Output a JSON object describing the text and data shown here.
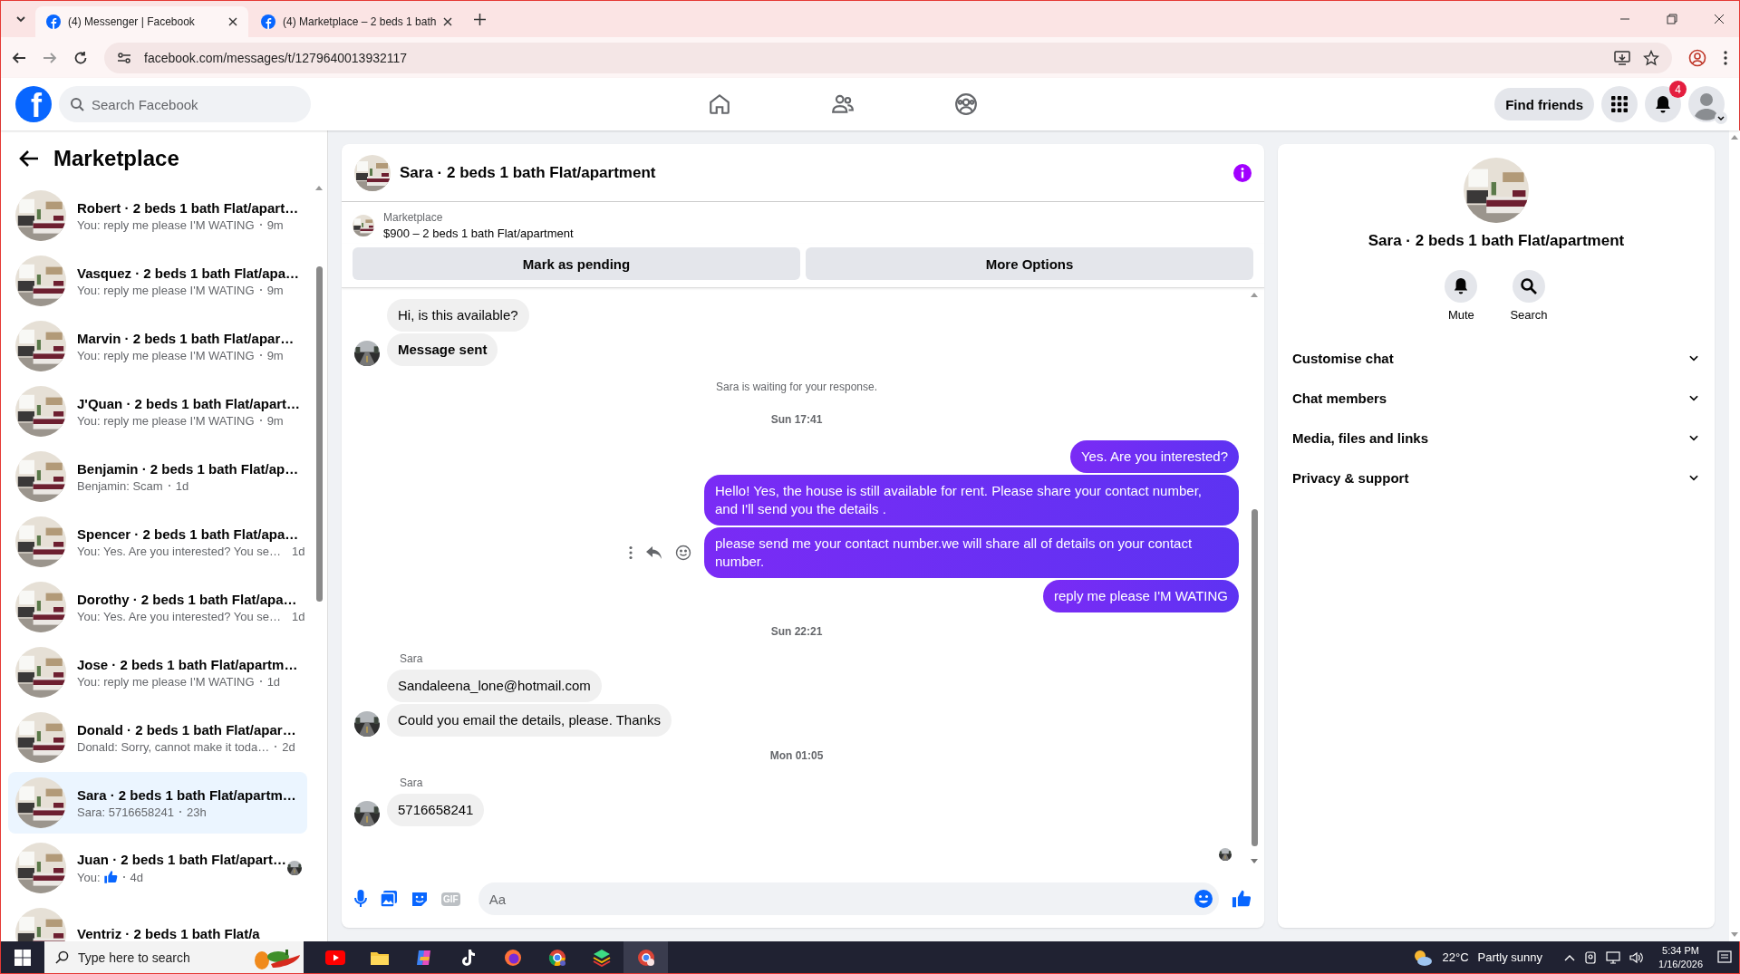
{
  "browser": {
    "tabs": [
      {
        "title": "(4) Messenger | Facebook",
        "selected": true
      },
      {
        "title": "(4) Marketplace – 2 beds 1 bath",
        "selected": false
      }
    ],
    "url": "facebook.com/messages/t/1279640013932117"
  },
  "topnav": {
    "logo": "f",
    "search_placeholder": "Search Facebook",
    "find_friends": "Find friends",
    "notification_count": "4"
  },
  "sidebar": {
    "title": "Marketplace",
    "conversations": [
      {
        "name": "Robert · 2 beds 1 bath Flat/apart…",
        "preview": "You: reply me please I'M WATING",
        "time": "9m",
        "kind": "text",
        "selected": false
      },
      {
        "name": "Vasquez · 2 beds 1 bath Flat/apa…",
        "preview": "You: reply me please I'M WATING",
        "time": "9m",
        "kind": "text",
        "selected": false
      },
      {
        "name": "Marvin · 2 beds 1 bath Flat/apar…",
        "preview": "You: reply me please I'M WATING",
        "time": "9m",
        "kind": "text",
        "selected": false
      },
      {
        "name": "J'Quan · 2 beds 1 bath Flat/apart…",
        "preview": "You: reply me please I'M WATING",
        "time": "9m",
        "kind": "text",
        "selected": false
      },
      {
        "name": "Benjamin · 2 beds 1 bath Flat/ap…",
        "preview": "Benjamin: Scam",
        "time": "1d",
        "kind": "text",
        "selected": false
      },
      {
        "name": "Spencer · 2 beds 1 bath Flat/apa…",
        "preview": "You: Yes. Are you interested? You se…",
        "time": "1d",
        "kind": "text",
        "selected": false
      },
      {
        "name": "Dorothy · 2 beds 1 bath Flat/apa…",
        "preview": "You: Yes. Are you interested? You se…",
        "time": "1d",
        "kind": "text",
        "selected": false
      },
      {
        "name": "Jose · 2 beds 1 bath Flat/apartm…",
        "preview": "You: reply me please I'M WATING",
        "time": "1d",
        "kind": "text",
        "selected": false
      },
      {
        "name": "Donald · 2 beds 1 bath Flat/apar…",
        "preview": "Donald: Sorry, cannot make it toda…",
        "time": "2d",
        "kind": "text",
        "selected": false
      },
      {
        "name": "Sara · 2 beds 1 bath Flat/apartm…",
        "preview": "Sara: 5716658241",
        "time": "23h",
        "kind": "text",
        "selected": true
      },
      {
        "name": "Juan · 2 beds 1 bath Flat/apart…",
        "preview": "You:",
        "time": "4d",
        "kind": "like",
        "selected": false
      },
      {
        "name": "Ventriz · 2 beds 1 bath Flat/a",
        "kind": "cut",
        "selected": false
      }
    ]
  },
  "chat": {
    "title": "Sara · 2 beds 1 bath Flat/apartment",
    "listing": {
      "label": "Marketplace",
      "text": "$900 – 2 beds 1 bath Flat/apartment"
    },
    "buttons": [
      "Mark as pending",
      "More Options"
    ],
    "messages": [
      {
        "kind": "incoming",
        "text": "Hi, is this available?",
        "avatar": false
      },
      {
        "kind": "incoming_bold",
        "text": "Message sent",
        "avatar": true
      },
      {
        "kind": "notice",
        "text": "Sara is waiting for your response."
      },
      {
        "kind": "time",
        "text": "Sun 17:41"
      },
      {
        "kind": "outgoing",
        "text": "Yes. Are you interested?",
        "actions": false
      },
      {
        "kind": "outgoing",
        "text": "Hello! Yes, the house is still available for rent. Please share your contact number, and I'll send you the details .",
        "actions": false
      },
      {
        "kind": "outgoing",
        "text": "please send me your contact number.we will share all of details on your contact number.",
        "actions": true
      },
      {
        "kind": "outgoing",
        "text": "reply me please I'M WATING",
        "actions": false
      },
      {
        "kind": "time",
        "text": "Sun 22:21"
      },
      {
        "kind": "sender",
        "text": "Sara"
      },
      {
        "kind": "incoming",
        "text": "Sandaleena_lone@hotmail.com",
        "avatar": false
      },
      {
        "kind": "incoming",
        "text": "Could you email the details, please. Thanks",
        "avatar": true
      },
      {
        "kind": "time",
        "text": "Mon 01:05"
      },
      {
        "kind": "sender",
        "text": "Sara"
      },
      {
        "kind": "incoming",
        "text": "5716658241",
        "avatar": true
      }
    ],
    "composer": {
      "gif_label": "GIF",
      "placeholder": "Aa"
    }
  },
  "info": {
    "title": "Sara · 2 beds 1 bath Flat/apartment",
    "actions": [
      {
        "kind": "mute",
        "label": "Mute"
      },
      {
        "kind": "search",
        "label": "Search"
      }
    ],
    "sections": [
      "Customise chat",
      "Chat members",
      "Media, files and links",
      "Privacy & support"
    ]
  },
  "taskbar": {
    "search_placeholder": "Type here to search",
    "temperature": "22°C",
    "weather": "Partly sunny",
    "time": "5:34 PM",
    "date": "1/16/2026"
  }
}
